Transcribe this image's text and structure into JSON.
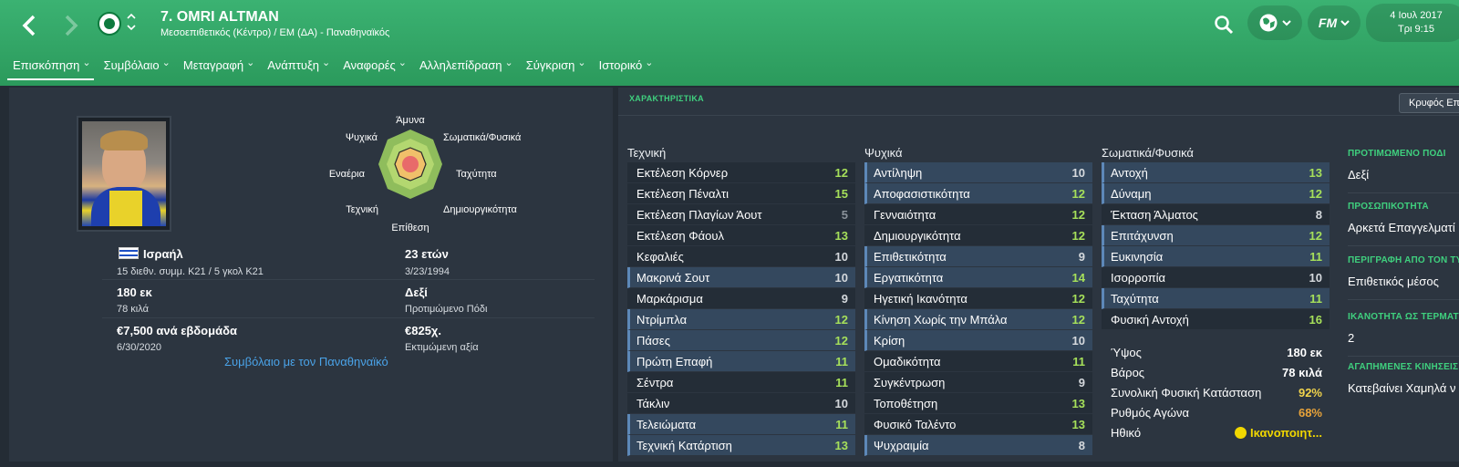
{
  "header": {
    "title": "7. OMRI ALTMAN",
    "subtitle": "Μεσοεπιθετικός (Κέντρο) / ΕΜ (ΔΑ) - Παναθηναϊκός",
    "date": "4 Ιουλ 2017",
    "time": "Τρι 9:15",
    "fm_label": "FM"
  },
  "tabs": [
    {
      "label": "Επισκόπηση"
    },
    {
      "label": "Συμβόλαιο"
    },
    {
      "label": "Μεταγραφή"
    },
    {
      "label": "Ανάπτυξη"
    },
    {
      "label": "Αναφορές"
    },
    {
      "label": "Αλληλεπίδραση"
    },
    {
      "label": "Σύγκριση"
    },
    {
      "label": "Ιστορικό"
    }
  ],
  "radar": {
    "labels": {
      "top": "Άμυνα",
      "top_right": "Σωματικά/Φυσικά",
      "right": "Ταχύτητα",
      "bottom_right": "Δημιουργικότητα",
      "bottom": "Επίθεση",
      "bottom_left": "Τεχνική",
      "left": "Εναέρια",
      "top_left": "Ψυχικά"
    }
  },
  "profile": {
    "nation": "Ισραήλ",
    "caps": "15 διεθν. συμμ. Κ21 / 5 γκολ Κ21",
    "age": "23 ετών",
    "dob": "3/23/1994",
    "height": "180 εκ",
    "weight": "78 κιλά",
    "foot": "Δεξί",
    "foot_label": "Προτιμώμενο Πόδι",
    "wage": "€7,500 ανά εβδομάδα",
    "contract_end": "6/30/2020",
    "value": "€825χ.",
    "value_label": "Εκτιμώμενη αξία",
    "contract_link": "Συμβόλαιο με τον Παναθηναϊκό"
  },
  "attributes": {
    "section_title": "ΧΑΡΑΚΤΗΡΙΣΤΙΚΑ",
    "hide_button": "Κρυφός Επ",
    "technical": {
      "title": "Τεχνική",
      "rows": [
        {
          "name": "Εκτέλεση Κόρνερ",
          "value": "12",
          "hl": false,
          "color": "#a6e05a"
        },
        {
          "name": "Εκτέλεση Πέναλτι",
          "value": "15",
          "hl": false,
          "color": "#a6e05a"
        },
        {
          "name": "Εκτέλεση Πλαγίων Άουτ",
          "value": "5",
          "hl": false,
          "color": "#8a929a"
        },
        {
          "name": "Εκτέλεση Φάουλ",
          "value": "13",
          "hl": false,
          "color": "#a6e05a"
        },
        {
          "name": "Κεφαλιές",
          "value": "10",
          "hl": false,
          "color": "#d5d9dd"
        },
        {
          "name": "Μακρινά Σουτ",
          "value": "10",
          "hl": true,
          "color": "#d5d9dd"
        },
        {
          "name": "Μαρκάρισμα",
          "value": "9",
          "hl": false,
          "color": "#d5d9dd"
        },
        {
          "name": "Ντρίμπλα",
          "value": "12",
          "hl": true,
          "color": "#a6e05a"
        },
        {
          "name": "Πάσες",
          "value": "12",
          "hl": true,
          "color": "#a6e05a"
        },
        {
          "name": "Πρώτη Επαφή",
          "value": "11",
          "hl": true,
          "color": "#a6e05a"
        },
        {
          "name": "Σέντρα",
          "value": "11",
          "hl": false,
          "color": "#a6e05a"
        },
        {
          "name": "Τάκλιν",
          "value": "10",
          "hl": false,
          "color": "#d5d9dd"
        },
        {
          "name": "Τελειώματα",
          "value": "11",
          "hl": true,
          "color": "#a6e05a"
        },
        {
          "name": "Τεχνική Κατάρτιση",
          "value": "13",
          "hl": true,
          "color": "#a6e05a"
        }
      ]
    },
    "mental": {
      "title": "Ψυχικά",
      "rows": [
        {
          "name": "Αντίληψη",
          "value": "10",
          "hl": true,
          "color": "#d5d9dd"
        },
        {
          "name": "Αποφασιστικότητα",
          "value": "12",
          "hl": true,
          "color": "#a6e05a"
        },
        {
          "name": "Γενναιότητα",
          "value": "12",
          "hl": false,
          "color": "#a6e05a"
        },
        {
          "name": "Δημιουργικότητα",
          "value": "12",
          "hl": false,
          "color": "#a6e05a"
        },
        {
          "name": "Επιθετικότητα",
          "value": "9",
          "hl": true,
          "color": "#d5d9dd"
        },
        {
          "name": "Εργατικότητα",
          "value": "14",
          "hl": true,
          "color": "#a6e05a"
        },
        {
          "name": "Ηγετική Ικανότητα",
          "value": "12",
          "hl": false,
          "color": "#a6e05a"
        },
        {
          "name": "Κίνηση Χωρίς την Μπάλα",
          "value": "12",
          "hl": true,
          "color": "#a6e05a"
        },
        {
          "name": "Κρίση",
          "value": "10",
          "hl": true,
          "color": "#d5d9dd"
        },
        {
          "name": "Ομαδικότητα",
          "value": "11",
          "hl": false,
          "color": "#a6e05a"
        },
        {
          "name": "Συγκέντρωση",
          "value": "9",
          "hl": false,
          "color": "#d5d9dd"
        },
        {
          "name": "Τοποθέτηση",
          "value": "13",
          "hl": false,
          "color": "#a6e05a"
        },
        {
          "name": "Φυσικό Ταλέντο",
          "value": "13",
          "hl": false,
          "color": "#a6e05a"
        },
        {
          "name": "Ψυχραιμία",
          "value": "8",
          "hl": true,
          "color": "#d5d9dd"
        }
      ]
    },
    "physical": {
      "title": "Σωματικά/Φυσικά",
      "rows": [
        {
          "name": "Αντοχή",
          "value": "13",
          "hl": true,
          "color": "#a6e05a"
        },
        {
          "name": "Δύναμη",
          "value": "12",
          "hl": true,
          "color": "#a6e05a"
        },
        {
          "name": "Έκταση Άλματος",
          "value": "8",
          "hl": false,
          "color": "#d5d9dd"
        },
        {
          "name": "Επιτάχυνση",
          "value": "12",
          "hl": true,
          "color": "#a6e05a"
        },
        {
          "name": "Ευκινησία",
          "value": "11",
          "hl": true,
          "color": "#a6e05a"
        },
        {
          "name": "Ισορροπία",
          "value": "10",
          "hl": false,
          "color": "#d5d9dd"
        },
        {
          "name": "Ταχύτητα",
          "value": "11",
          "hl": true,
          "color": "#a6e05a"
        },
        {
          "name": "Φυσική Αντοχή",
          "value": "16",
          "hl": false,
          "color": "#a6e05a"
        }
      ]
    }
  },
  "stats": [
    {
      "name": "Ύψος",
      "value": "180 εκ",
      "color": "#ffffff"
    },
    {
      "name": "Βάρος",
      "value": "78 κιλά",
      "color": "#ffffff"
    },
    {
      "name": "Συνολική Φυσική Κατάσταση",
      "value": "92%",
      "color": "#f1d44c"
    },
    {
      "name": "Ρυθμός Αγώνα",
      "value": "68%",
      "color": "#e8a33a"
    },
    {
      "name": "Ηθικό",
      "value": "Ικανοποιητ...",
      "color": "#f1d700"
    }
  ],
  "side": [
    {
      "heading": "ΠΡΟΤΙΜΩΜΕΝΟ ΠΟΔΙ",
      "value": "Δεξί"
    },
    {
      "heading": "ΠΡΟΣΩΠΙΚΟΤΗΤΑ",
      "value": "Αρκετά Επαγγελματί"
    },
    {
      "heading": "ΠΕΡΙΓΡΑΦΗ ΑΠΟ ΤΟΝ ΤΥ",
      "value": "Επιθετικός μέσος"
    },
    {
      "heading": "ΙΚΑΝΟΤΗΤΑ ΩΣ ΤΕΡΜΑΤΟ",
      "value": "2"
    },
    {
      "heading": "ΑΓΑΠΗΜΕΝΕΣ ΚΙΝΗΣΕΙΣ",
      "value": "Κατεβαίνει Χαμηλά ν"
    }
  ]
}
